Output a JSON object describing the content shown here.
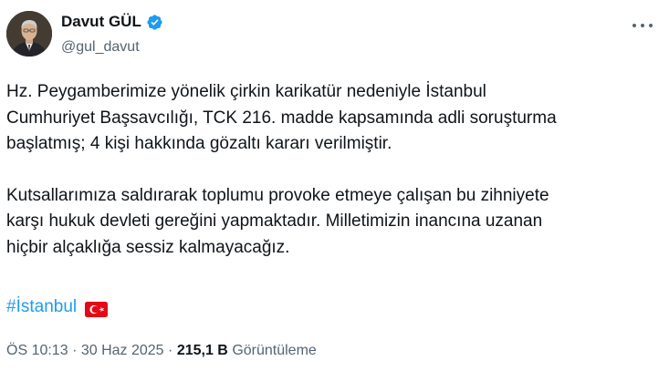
{
  "author": {
    "display_name": "Davut GÜL",
    "handle": "@gul_davut",
    "verified": true,
    "avatar_icon": "profile-photo"
  },
  "tweet": {
    "paragraph1": "Hz. Peygamberimize yönelik çirkin karikatür nedeniyle İstanbul\nCumhuriyet Başsavcılığı, TCK 216. madde kapsamında adli soruşturma\nbaşlatmış; 4 kişi hakkında gözaltı kararı verilmiştir.",
    "paragraph2": "Kutsallarımıza saldırarak toplumu provoke etmeye çalışan bu zihniyete\nkarşı hukuk devleti gereğini yapmaktadır. Milletimizin inancına uzanan\nhiçbir alçaklığa sessiz kalmayacağız.",
    "hashtag": "#İstanbul",
    "flag_icon": "turkey-flag"
  },
  "meta": {
    "time": "ÖS 10:13",
    "separator1": "·",
    "date": "30 Haz 2025",
    "separator2": "·",
    "views_count": "215,1 B",
    "views_label": "Görüntüleme"
  },
  "colors": {
    "text": "#0f1419",
    "secondary": "#536471",
    "link": "#1d9bf0",
    "verified": "#1d9bf0",
    "flag_red": "#e30a17"
  }
}
